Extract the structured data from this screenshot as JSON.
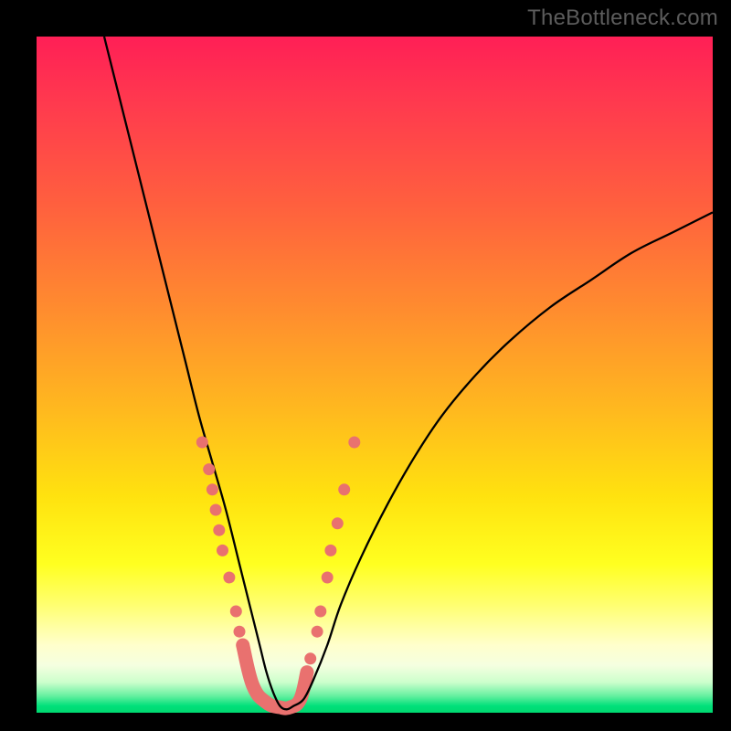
{
  "watermark": "TheBottleneck.com",
  "chart_data": {
    "type": "line",
    "title": "",
    "xlabel": "",
    "ylabel": "",
    "xlim": [
      0,
      100
    ],
    "ylim": [
      0,
      100
    ],
    "series": [
      {
        "name": "curve",
        "color": "#000000",
        "x": [
          10,
          12,
          14,
          16,
          18,
          20,
          22,
          24,
          26,
          28,
          30,
          31,
          32,
          33,
          34,
          35,
          36,
          37,
          38,
          39.5,
          41,
          43,
          45,
          48,
          52,
          56,
          60,
          65,
          70,
          76,
          82,
          88,
          94,
          100
        ],
        "y": [
          100,
          92,
          84,
          76,
          68,
          60,
          52,
          44,
          37,
          30,
          22,
          18,
          14,
          10,
          6,
          3,
          1,
          0.5,
          1,
          2,
          5,
          10,
          16,
          23,
          31,
          38,
          44,
          50,
          55,
          60,
          64,
          68,
          71,
          74
        ]
      }
    ],
    "scatter": {
      "name": "dots",
      "color": "#e9716f",
      "radius": 6.5,
      "points": [
        [
          24.5,
          40
        ],
        [
          25.5,
          36
        ],
        [
          26,
          33
        ],
        [
          26.5,
          30
        ],
        [
          27,
          27
        ],
        [
          27.5,
          24
        ],
        [
          28.5,
          20
        ],
        [
          29.5,
          15
        ],
        [
          30,
          12
        ],
        [
          30.5,
          10
        ],
        [
          40.5,
          8
        ],
        [
          41.5,
          12
        ],
        [
          42,
          15
        ],
        [
          43,
          20
        ],
        [
          43.5,
          24
        ],
        [
          44.5,
          28
        ],
        [
          45.5,
          33
        ],
        [
          47,
          40
        ]
      ]
    },
    "thick_band": {
      "color": "#e9716f",
      "width": 15,
      "path_x": [
        30.5,
        32,
        34,
        36,
        37.5,
        39,
        40
      ],
      "path_y": [
        10,
        4,
        1.5,
        0.8,
        0.8,
        2,
        6
      ]
    }
  }
}
